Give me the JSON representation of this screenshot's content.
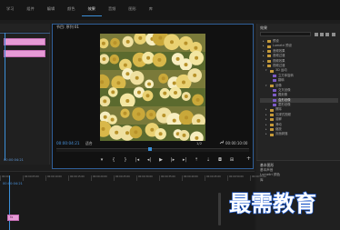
{
  "tabs": [
    "学习",
    "组件",
    "编辑",
    "颜色",
    "效果",
    "音频",
    "图形",
    "库"
  ],
  "active_tab": 4,
  "program": {
    "title": "节目: 序列 01",
    "timecode_current": "00:00:04:21",
    "fit_label": "适合",
    "zoom_label": "1/2",
    "timecode_total": "00:00:10:00"
  },
  "transport": [
    "marker-icon",
    "mark-in-icon",
    "mark-out-icon",
    "go-to-in-icon",
    "step-back-icon",
    "play-icon",
    "step-forward-icon",
    "go-to-out-icon",
    "lift-icon",
    "extract-icon",
    "export-frame-icon",
    "button-editor-icon"
  ],
  "effects_panel": {
    "title": "效果",
    "items": [
      {
        "label": "预设",
        "type": "folder",
        "indent": 1
      },
      {
        "label": "Lumetri 预设",
        "type": "folder",
        "indent": 1
      },
      {
        "label": "音频效果",
        "type": "folder",
        "indent": 1
      },
      {
        "label": "音频过渡",
        "type": "folder",
        "indent": 1
      },
      {
        "label": "视频效果",
        "type": "folder",
        "indent": 1
      },
      {
        "label": "视频过渡",
        "type": "folder",
        "indent": 1,
        "open": true
      },
      {
        "label": "3D 运动",
        "type": "folder",
        "indent": 2,
        "open": true
      },
      {
        "label": "立方体旋转",
        "type": "fx",
        "indent": 3
      },
      {
        "label": "翻转",
        "type": "fx",
        "indent": 3
      },
      {
        "label": "划像",
        "type": "folder",
        "indent": 2,
        "open": true
      },
      {
        "label": "交叉划像",
        "type": "fx",
        "indent": 3
      },
      {
        "label": "圆划像",
        "type": "fx",
        "indent": 3
      },
      {
        "label": "盒形划像",
        "type": "fx",
        "indent": 3,
        "selected": true
      },
      {
        "label": "菱形划像",
        "type": "fx",
        "indent": 3
      },
      {
        "label": "擦除",
        "type": "folder",
        "indent": 2
      },
      {
        "label": "沉浸式视频",
        "type": "folder",
        "indent": 2
      },
      {
        "label": "溶解",
        "type": "folder",
        "indent": 2
      },
      {
        "label": "滑动",
        "type": "folder",
        "indent": 2
      },
      {
        "label": "缩放",
        "type": "folder",
        "indent": 2
      },
      {
        "label": "页面剥落",
        "type": "folder",
        "indent": 2
      }
    ]
  },
  "lower_panel": {
    "title": "基本图形",
    "item1": "基本声音",
    "item2": "Lumetri 颜色",
    "item3": "库"
  },
  "left_strip": {
    "timecode": "00:00:04:21"
  },
  "timeline": {
    "current": "00:00:04:21",
    "ruler": [
      "00:00",
      "00:00:05:00",
      "00:00:10:00",
      "00:00:15:00",
      "00:00:20:00",
      "00:00:25:00",
      "00:00:30:00",
      "00:00:35:00",
      "00:00:40:00",
      "00:00:45:00",
      "00:00:50:00",
      "00:00:55:00"
    ],
    "clip_label": "fx"
  },
  "watermark": "最需教育",
  "colors": {
    "accent": "#3b8fd8",
    "clip_pink": "#e69ad6",
    "folder": "#c59a3a",
    "fx": "#7c5cc5"
  }
}
